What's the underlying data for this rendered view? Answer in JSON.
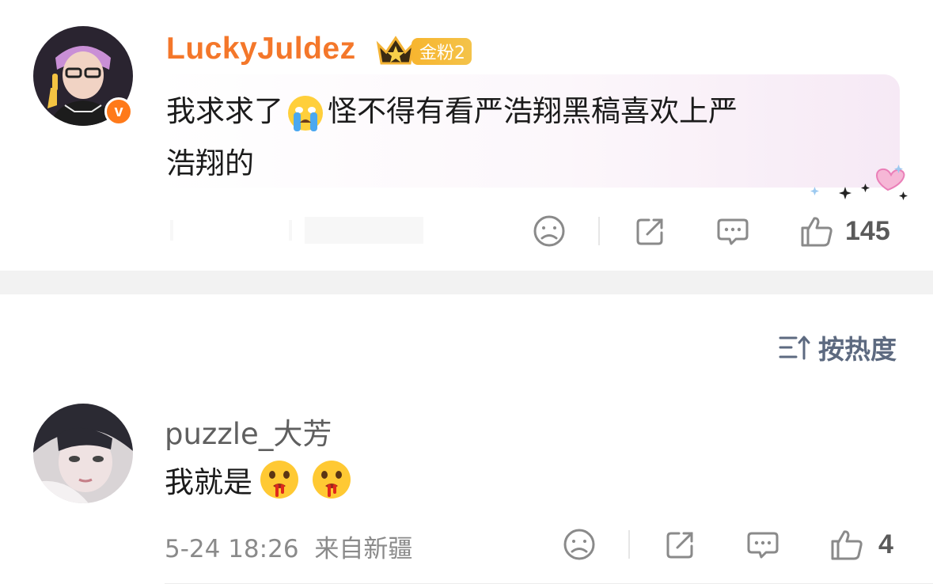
{
  "post": {
    "username": "LuckyJuldez",
    "fan_badge": "金粉2",
    "content_line1": "我求求了",
    "content_line1_rest": "怪不得有看严浩翔黑稿喜欢上严",
    "content_line2": "浩翔的",
    "like_count": "145"
  },
  "sort": {
    "label": "按热度"
  },
  "comment": {
    "username": "puzzle_大芳",
    "content": "我就是",
    "time": "5-24 18:26",
    "location": "来自新疆",
    "like_count": "4"
  },
  "colors": {
    "username_orange": "#f4772a",
    "sort_blue": "#5d6a80",
    "divider_gray": "#f2f2f2",
    "icon_gray": "#8a8a8a"
  },
  "icons": [
    "verified-v-icon",
    "crown-icon",
    "crying-emoji-icon",
    "heart-sparkle-icon",
    "sad-face-icon",
    "share-icon",
    "comment-icon",
    "like-icon",
    "sort-icon",
    "nosebleed-emoji-icon"
  ]
}
